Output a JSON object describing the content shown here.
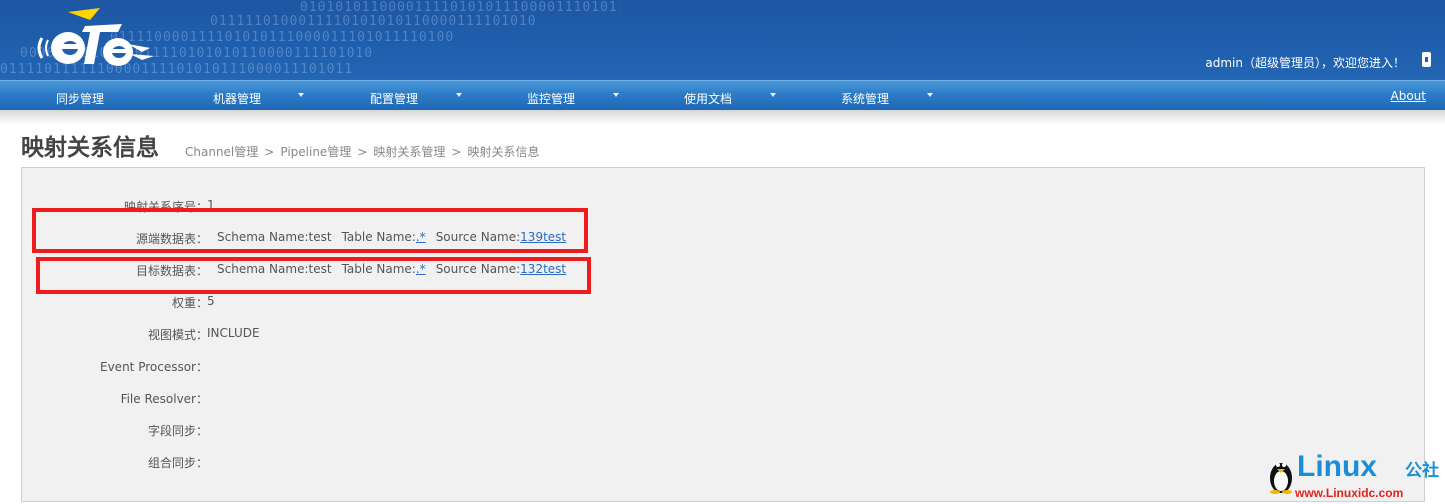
{
  "header": {
    "user_info": "admin（超级管理员），欢迎您进入！"
  },
  "nav": {
    "items": [
      {
        "label": "同步管理"
      },
      {
        "label": "机器管理"
      },
      {
        "label": "配置管理"
      },
      {
        "label": "监控管理"
      },
      {
        "label": "使用文档"
      },
      {
        "label": "系统管理"
      }
    ],
    "about": "About"
  },
  "page": {
    "title": "映射关系信息",
    "breadcrumb": [
      "Channel管理",
      "Pipeline管理",
      "映射关系管理",
      "映射关系信息"
    ],
    "breadcrumb_sep": ">"
  },
  "details": {
    "seq_label": "映射关系序号：",
    "seq_value": "1",
    "source_label": "源端数据表：",
    "target_label": "目标数据表：",
    "schema_name_label": "Schema Name:",
    "table_name_label": "Table Name:",
    "source_name_label": "Source Name:",
    "source": {
      "schema": "test",
      "table": ".*",
      "source_name": "139test"
    },
    "target": {
      "schema": "test",
      "table": ".*",
      "source_name": "132test"
    },
    "weight_label": "权重：",
    "weight_value": "5",
    "view_mode_label": "视图模式：",
    "view_mode_value": "INCLUDE",
    "event_processor_label": "Event Processor：",
    "file_resolver_label": "File Resolver：",
    "field_sync_label": "字段同步：",
    "group_sync_label": "组合同步："
  },
  "watermark": {
    "brand": "Linux",
    "brand_cn": "公社",
    "url": "www.Linuxidc.com"
  },
  "colors": {
    "header_bg": "#1f5fae",
    "nav_bg": "#2d7cc7",
    "highlight": "#ee1c1c",
    "link": "#2a6ac8",
    "value_red": "#e01c1c"
  }
}
